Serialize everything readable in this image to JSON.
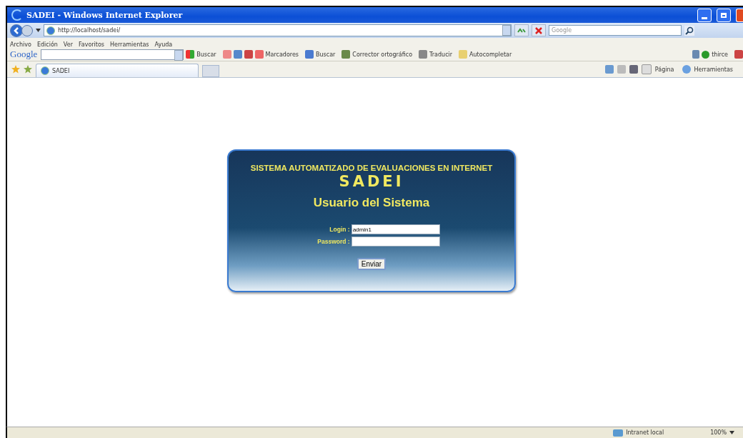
{
  "window": {
    "title": "SADEI - Windows Internet Explorer"
  },
  "address_bar": {
    "url": "http://localhost/sadei/",
    "search_placeholder": "Google"
  },
  "menu": [
    "Archivo",
    "Edición",
    "Ver",
    "Favoritos",
    "Herramientas",
    "Ayuda"
  ],
  "google_toolbar": {
    "logo": "Google",
    "items": [
      "Buscar",
      "Marcadores",
      "Buscar",
      "Corrector ortográfico",
      "Traducir",
      "Autocompletar"
    ],
    "user": "thirce"
  },
  "tabs": [
    {
      "label": "SADEI",
      "selected": true
    }
  ],
  "command_bar": [
    "Página",
    "Herramientas"
  ],
  "login_panel": {
    "heading": "SISTEMA AUTOMATIZADO DE EVALUACIONES EN INTERNET",
    "logo": "SADEI",
    "title": "Usuario del Sistema",
    "fields": [
      {
        "label": "Login :",
        "value": "admin1"
      },
      {
        "label": "Password :"
      }
    ],
    "button": "Enviar"
  },
  "status_bar": {
    "zone": "Intranet local",
    "zoom": "100%"
  }
}
